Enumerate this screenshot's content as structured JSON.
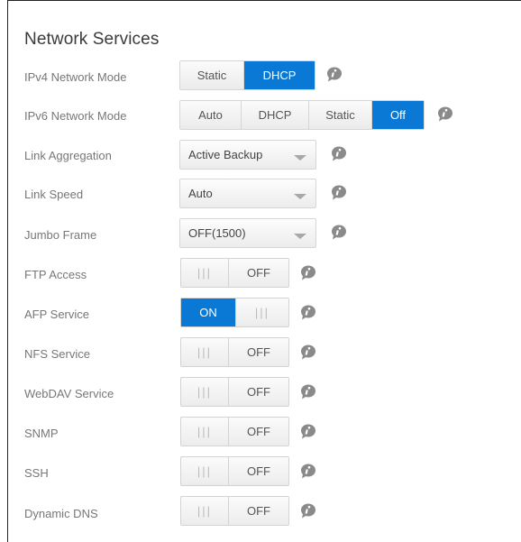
{
  "title": "Network Services",
  "ipv4": {
    "label": "IPv4 Network Mode",
    "options": [
      "Static",
      "DHCP"
    ],
    "selected": "DHCP"
  },
  "ipv6": {
    "label": "IPv6 Network Mode",
    "options": [
      "Auto",
      "DHCP",
      "Static",
      "Off"
    ],
    "selected": "Off"
  },
  "link_aggregation": {
    "label": "Link Aggregation",
    "value": "Active Backup"
  },
  "link_speed": {
    "label": "Link Speed",
    "value": "Auto"
  },
  "jumbo_frame": {
    "label": "Jumbo Frame",
    "value": "OFF(1500)"
  },
  "toggles": [
    {
      "label": "FTP Access",
      "state": "OFF"
    },
    {
      "label": "AFP Service",
      "state": "ON"
    },
    {
      "label": "NFS Service",
      "state": "OFF"
    },
    {
      "label": "WebDAV Service",
      "state": "OFF"
    },
    {
      "label": "SNMP",
      "state": "OFF"
    },
    {
      "label": "SSH",
      "state": "OFF"
    },
    {
      "label": "Dynamic DNS",
      "state": "OFF"
    }
  ],
  "grip_glyph": "|||",
  "colors": {
    "accent": "#0a79d6",
    "info_icon": "#8a8a8a"
  },
  "icons": {
    "info": "info-icon",
    "dropdown": "chevron-down-icon"
  }
}
